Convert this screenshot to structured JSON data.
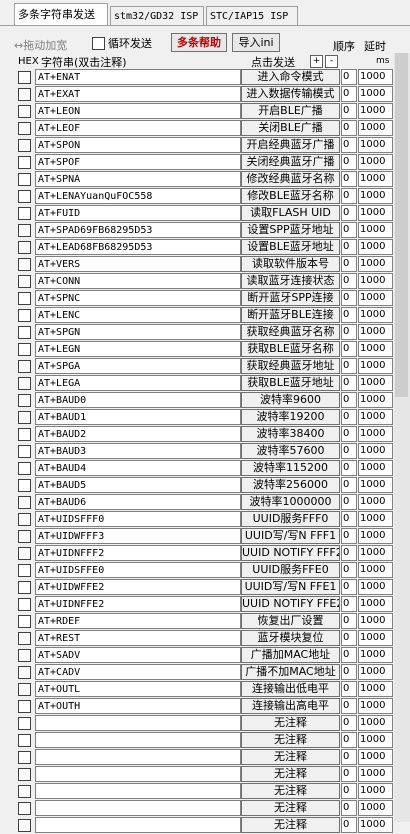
{
  "tabs": [
    "多条字符串发送",
    "stm32/GD32 ISP",
    "STC/IAP15 ISP"
  ],
  "toolbar": {
    "drag_label": "↔拖动加宽",
    "loop_label": "循环发送",
    "help_label": "多条帮助",
    "import_label": "导入ini"
  },
  "headers": {
    "hex": "HEX",
    "string": "字符串(双击注释)",
    "click_send": "点击发送",
    "plus": "+",
    "minus": "-",
    "order": "顺序",
    "delay": "延时",
    "ms": "ms"
  },
  "rows": [
    {
      "cmd": "AT+ENAT",
      "label": "进入命令模式",
      "order": "0",
      "delay": "1000"
    },
    {
      "cmd": "AT+EXAT",
      "label": "进入数据传输模式",
      "order": "0",
      "delay": "1000"
    },
    {
      "cmd": "AT+LEON",
      "label": "开启BLE广播",
      "order": "0",
      "delay": "1000"
    },
    {
      "cmd": "AT+LEOF",
      "label": "关闭BLE广播",
      "order": "0",
      "delay": "1000"
    },
    {
      "cmd": "AT+SPON",
      "label": "开启经典蓝牙广播",
      "order": "0",
      "delay": "1000"
    },
    {
      "cmd": "AT+SPOF",
      "label": "关闭经典蓝牙广播",
      "order": "0",
      "delay": "1000"
    },
    {
      "cmd": "AT+SPNA",
      "label": "修改经典蓝牙名称",
      "order": "0",
      "delay": "1000"
    },
    {
      "cmd": "AT+LENAYuanQuFOC558",
      "label": "修改BLE蓝牙名称",
      "order": "0",
      "delay": "1000"
    },
    {
      "cmd": "AT+FUID",
      "label": "读取FLASH UID",
      "order": "0",
      "delay": "1000"
    },
    {
      "cmd": "AT+SPAD69FB68295D53",
      "label": "设置SPP蓝牙地址",
      "order": "0",
      "delay": "1000"
    },
    {
      "cmd": "AT+LEAD68FB68295D53",
      "label": "设置BLE蓝牙地址",
      "order": "0",
      "delay": "1000"
    },
    {
      "cmd": "AT+VERS",
      "label": "读取软件版本号",
      "order": "0",
      "delay": "1000"
    },
    {
      "cmd": "AT+CONN",
      "label": "读取蓝牙连接状态",
      "order": "0",
      "delay": "1000"
    },
    {
      "cmd": "AT+SPNC",
      "label": "断开蓝牙SPP连接",
      "order": "0",
      "delay": "1000"
    },
    {
      "cmd": "AT+LENC",
      "label": "断开蓝牙BLE连接",
      "order": "0",
      "delay": "1000"
    },
    {
      "cmd": "AT+SPGN",
      "label": "获取经典蓝牙名称",
      "order": "0",
      "delay": "1000"
    },
    {
      "cmd": "AT+LEGN",
      "label": "获取BLE蓝牙名称",
      "order": "0",
      "delay": "1000"
    },
    {
      "cmd": "AT+SPGA",
      "label": "获取经典蓝牙地址",
      "order": "0",
      "delay": "1000"
    },
    {
      "cmd": "AT+LEGA",
      "label": "获取BLE蓝牙地址",
      "order": "0",
      "delay": "1000"
    },
    {
      "cmd": "AT+BAUD0",
      "label": "波特率9600",
      "order": "0",
      "delay": "1000"
    },
    {
      "cmd": "AT+BAUD1",
      "label": "波特率19200",
      "order": "0",
      "delay": "1000"
    },
    {
      "cmd": "AT+BAUD2",
      "label": "波特率38400",
      "order": "0",
      "delay": "1000"
    },
    {
      "cmd": "AT+BAUD3",
      "label": "波特率57600",
      "order": "0",
      "delay": "1000"
    },
    {
      "cmd": "AT+BAUD4",
      "label": "波特率115200",
      "order": "0",
      "delay": "1000"
    },
    {
      "cmd": "AT+BAUD5",
      "label": "波特率256000",
      "order": "0",
      "delay": "1000"
    },
    {
      "cmd": "AT+BAUD6",
      "label": "波特率1000000",
      "order": "0",
      "delay": "1000"
    },
    {
      "cmd": "AT+UIDSFFF0",
      "label": "UUID服务FFF0",
      "order": "0",
      "delay": "1000"
    },
    {
      "cmd": "AT+UIDWFFF3",
      "label": "UUID写/写N FFF1",
      "order": "0",
      "delay": "1000"
    },
    {
      "cmd": "AT+UIDNFFF2",
      "label": "UUID NOTIFY FFF2",
      "order": "0",
      "delay": "1000"
    },
    {
      "cmd": "AT+UIDSFFE0",
      "label": "UUID服务FFE0",
      "order": "0",
      "delay": "1000"
    },
    {
      "cmd": "AT+UIDWFFE2",
      "label": "UUID写/写N FFE1",
      "order": "0",
      "delay": "1000"
    },
    {
      "cmd": "AT+UIDNFFE2",
      "label": "UUID NOTIFY FFE2",
      "order": "0",
      "delay": "1000"
    },
    {
      "cmd": "AT+RDEF",
      "label": "恢复出厂设置",
      "order": "0",
      "delay": "1000"
    },
    {
      "cmd": "AT+REST",
      "label": "蓝牙模块复位",
      "order": "0",
      "delay": "1000"
    },
    {
      "cmd": "AT+SADV",
      "label": "广播加MAC地址",
      "order": "0",
      "delay": "1000"
    },
    {
      "cmd": "AT+CADV",
      "label": "广播不加MAC地址",
      "order": "0",
      "delay": "1000"
    },
    {
      "cmd": "AT+OUTL",
      "label": "连接输出低电平",
      "order": "0",
      "delay": "1000"
    },
    {
      "cmd": "AT+OUTH",
      "label": "连接输出高电平",
      "order": "0",
      "delay": "1000"
    },
    {
      "cmd": "",
      "label": "无注释",
      "order": "0",
      "delay": "1000"
    },
    {
      "cmd": "",
      "label": "无注释",
      "order": "0",
      "delay": "1000"
    },
    {
      "cmd": "",
      "label": "无注释",
      "order": "0",
      "delay": "1000"
    },
    {
      "cmd": "",
      "label": "无注释",
      "order": "0",
      "delay": "1000"
    },
    {
      "cmd": "",
      "label": "无注释",
      "order": "0",
      "delay": "1000"
    },
    {
      "cmd": "",
      "label": "无注释",
      "order": "0",
      "delay": "1000"
    },
    {
      "cmd": "",
      "label": "无注释",
      "order": "0",
      "delay": "1000"
    }
  ]
}
